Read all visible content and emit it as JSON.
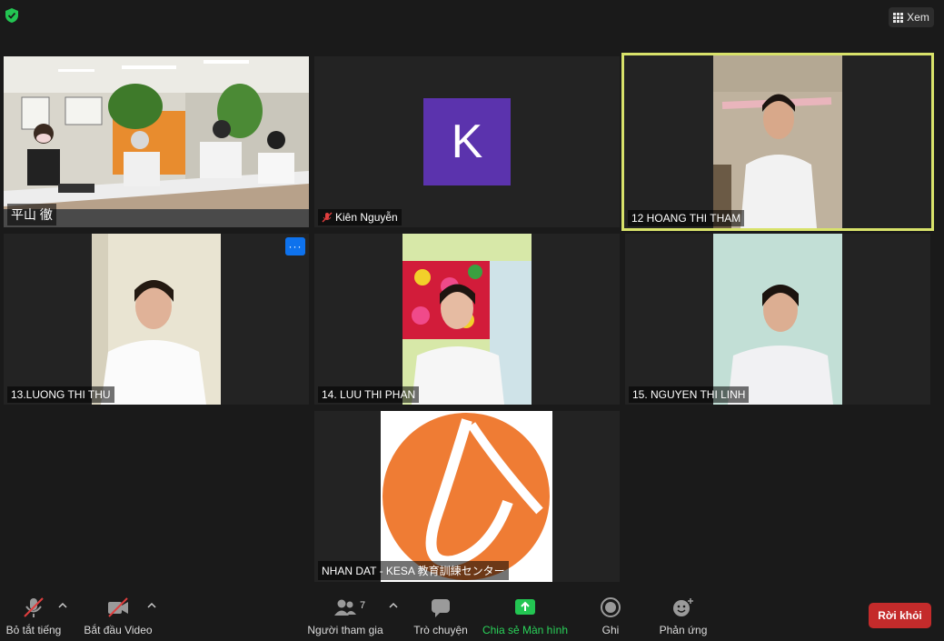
{
  "top_bar": {
    "view_label": "Xem"
  },
  "tiles": [
    {
      "name": "平山 徹"
    },
    {
      "name": "Kiên Nguyễn",
      "avatar_letter": "K",
      "muted": true
    },
    {
      "name": "12 HOANG THI THAM",
      "active_speaker": true
    },
    {
      "name": "13.LUONG THI THU",
      "more": "···"
    },
    {
      "name": "14. LUU THI PHAN"
    },
    {
      "name": "15. NGUYEN THI LINH"
    },
    {
      "name": "NHAN DAT - KESA 教育訓練センター"
    }
  ],
  "toolbar": {
    "mute_label": "Bỏ tắt tiếng",
    "video_label": "Bắt đầu Video",
    "participants_label": "Người tham gia",
    "participants_count": "7",
    "chat_label": "Trò chuyện",
    "share_label": "Chia sẻ Màn hình",
    "record_label": "Ghi",
    "reactions_label": "Phản ứng",
    "leave_label": "Rời khỏi"
  },
  "colors": {
    "accent": "#0e72ed",
    "active_border": "#d8e26a",
    "share_green": "#2ad35a",
    "leave_red": "#c42b2b",
    "avatar_purple": "#5b33ad",
    "logo_orange": "#ef7c34"
  }
}
